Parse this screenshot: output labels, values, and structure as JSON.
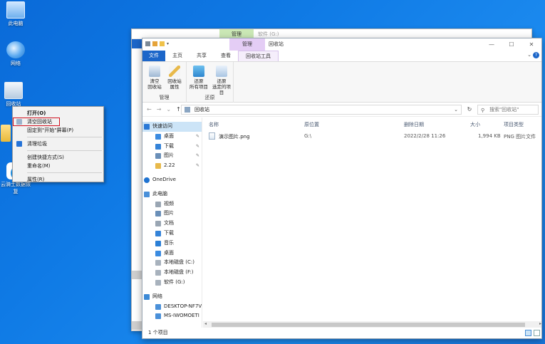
{
  "desktop": {
    "icons": [
      {
        "label": "此电脑"
      },
      {
        "label": "网络"
      },
      {
        "label": "回收站"
      },
      {
        "label": "云骑士数据恢复"
      }
    ]
  },
  "context_menu": {
    "items": [
      {
        "label": "打开(O)"
      },
      {
        "label": "清空回收站"
      },
      {
        "label": "固定到\"开始\"屏幕(P)"
      },
      {
        "label": "清理垃圾"
      },
      {
        "label": "创建快捷方式(S)"
      },
      {
        "label": "重命名(M)"
      },
      {
        "label": "属性(R)"
      }
    ]
  },
  "back_window": {
    "manage_label": "管理",
    "title": "软件 (G:)"
  },
  "window": {
    "manage_label": "管理",
    "title": "回收站",
    "controls": {
      "minimize": "—",
      "maximize": "☐",
      "close": "✕"
    },
    "tabs": [
      "文件",
      "主页",
      "共享",
      "查看",
      "回收站工具"
    ],
    "ribbon": {
      "groups": [
        {
          "label": "管理",
          "buttons": [
            "清空\n回收站",
            "回收站\n属性"
          ]
        },
        {
          "label": "还原",
          "buttons": [
            "还原\n所有项目",
            "还原\n选定的项目"
          ]
        }
      ]
    },
    "address": {
      "path": "回收站",
      "search_placeholder": "搜索\"回收站\""
    },
    "nav_pane": {
      "quick_access": "快速访问",
      "quick_items": [
        "桌面",
        "下载",
        "图片",
        "2.22"
      ],
      "onedrive": "OneDrive",
      "this_pc": "此电脑",
      "pc_items": [
        "视频",
        "图片",
        "文档",
        "下载",
        "音乐",
        "桌面",
        "本地磁盘 (C:)",
        "本地磁盘 (F:)",
        "软件 (G:)"
      ],
      "network": "网络",
      "network_items": [
        "DESKTOP-NF7V",
        "MS-IWOMOETI"
      ]
    },
    "list": {
      "columns": [
        "名称",
        "原位置",
        "删除日期",
        "大小",
        "项目类型"
      ],
      "rows": [
        {
          "name": "演示图片.png",
          "location": "G:\\",
          "date": "2022/2/28 11:26",
          "size": "1,994 KB",
          "type": "PNG 图片文件"
        }
      ]
    },
    "status": "1 个项目"
  }
}
